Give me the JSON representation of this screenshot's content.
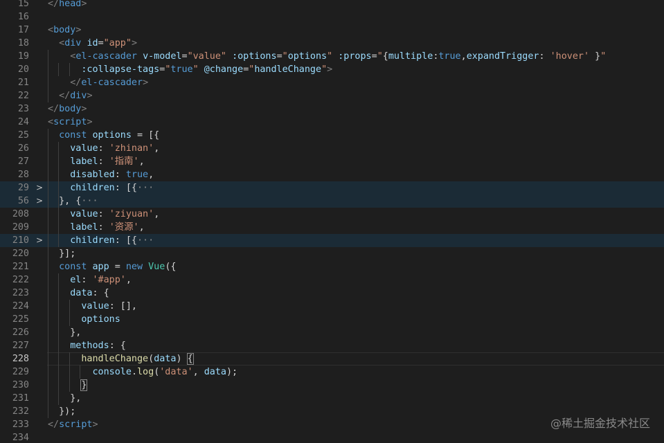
{
  "editor": {
    "lines": [
      {
        "num": "15",
        "segs": [
          [
            "t",
            "</"
          ],
          [
            "tn",
            "head"
          ],
          [
            "t",
            ">"
          ]
        ]
      },
      {
        "num": "16",
        "segs": []
      },
      {
        "num": "17",
        "segs": [
          [
            "t",
            "<"
          ],
          [
            "tn",
            "body"
          ],
          [
            "t",
            ">"
          ]
        ]
      },
      {
        "num": "18",
        "segs": [
          [
            "p",
            "  "
          ],
          [
            "t",
            "<"
          ],
          [
            "tn",
            "div"
          ],
          [
            "p",
            " "
          ],
          [
            "an",
            "id"
          ],
          [
            "p",
            "="
          ],
          [
            "s",
            "\"app\""
          ],
          [
            "t",
            ">"
          ]
        ]
      },
      {
        "num": "19",
        "segs": [
          [
            "p",
            "    "
          ],
          [
            "t",
            "<"
          ],
          [
            "tn",
            "el-cascader"
          ],
          [
            "p",
            " "
          ],
          [
            "an",
            "v-model"
          ],
          [
            "p",
            "="
          ],
          [
            "s",
            "\"value\""
          ],
          [
            "p",
            " "
          ],
          [
            "an",
            ":options"
          ],
          [
            "p",
            "="
          ],
          [
            "s",
            "\""
          ],
          [
            "v",
            "options"
          ],
          [
            "s",
            "\""
          ],
          [
            "p",
            " "
          ],
          [
            "an",
            ":props"
          ],
          [
            "p",
            "="
          ],
          [
            "s",
            "\""
          ],
          [
            "p",
            "{"
          ],
          [
            "v",
            "multiple"
          ],
          [
            "p",
            ":"
          ],
          [
            "k",
            "true"
          ],
          [
            "p",
            ","
          ],
          [
            "v",
            "expandTrigger"
          ],
          [
            "p",
            ": "
          ],
          [
            "s",
            "'hover'"
          ],
          [
            "p",
            " }"
          ],
          [
            "s",
            "\""
          ]
        ]
      },
      {
        "num": "20",
        "segs": [
          [
            "p",
            "      "
          ],
          [
            "an",
            ":collapse-tags"
          ],
          [
            "p",
            "="
          ],
          [
            "s",
            "\""
          ],
          [
            "k",
            "true"
          ],
          [
            "s",
            "\""
          ],
          [
            "p",
            " "
          ],
          [
            "an",
            "@change"
          ],
          [
            "p",
            "="
          ],
          [
            "s",
            "\""
          ],
          [
            "v",
            "handleChange"
          ],
          [
            "s",
            "\""
          ],
          [
            "t",
            ">"
          ]
        ]
      },
      {
        "num": "21",
        "segs": [
          [
            "p",
            "    "
          ],
          [
            "t",
            "</"
          ],
          [
            "tn",
            "el-cascader"
          ],
          [
            "t",
            ">"
          ]
        ]
      },
      {
        "num": "22",
        "segs": [
          [
            "p",
            "  "
          ],
          [
            "t",
            "</"
          ],
          [
            "tn",
            "div"
          ],
          [
            "t",
            ">"
          ]
        ]
      },
      {
        "num": "23",
        "segs": [
          [
            "t",
            "</"
          ],
          [
            "tn",
            "body"
          ],
          [
            "t",
            ">"
          ]
        ]
      },
      {
        "num": "24",
        "segs": [
          [
            "t",
            "<"
          ],
          [
            "tn",
            "script"
          ],
          [
            "t",
            ">"
          ]
        ]
      },
      {
        "num": "25",
        "segs": [
          [
            "p",
            "  "
          ],
          [
            "k",
            "const"
          ],
          [
            "p",
            " "
          ],
          [
            "v",
            "options"
          ],
          [
            "p",
            " = [{"
          ]
        ]
      },
      {
        "num": "26",
        "segs": [
          [
            "p",
            "    "
          ],
          [
            "v",
            "value"
          ],
          [
            "p",
            ": "
          ],
          [
            "s",
            "'zhinan'"
          ],
          [
            "p",
            ","
          ]
        ]
      },
      {
        "num": "27",
        "segs": [
          [
            "p",
            "    "
          ],
          [
            "v",
            "label"
          ],
          [
            "p",
            ": "
          ],
          [
            "s",
            "'指南'"
          ],
          [
            "p",
            ","
          ]
        ]
      },
      {
        "num": "28",
        "segs": [
          [
            "p",
            "    "
          ],
          [
            "v",
            "disabled"
          ],
          [
            "p",
            ": "
          ],
          [
            "k",
            "true"
          ],
          [
            "p",
            ","
          ]
        ]
      },
      {
        "num": "29",
        "segs": [
          [
            "p",
            "    "
          ],
          [
            "v",
            "children"
          ],
          [
            "p",
            ": [{"
          ],
          [
            "dots",
            "···"
          ]
        ],
        "fold": ">",
        "hl": true
      },
      {
        "num": "56",
        "segs": [
          [
            "p",
            "  }, {"
          ],
          [
            "dots",
            "···"
          ]
        ],
        "fold": ">",
        "hl": true
      },
      {
        "num": "208",
        "segs": [
          [
            "p",
            "    "
          ],
          [
            "v",
            "value"
          ],
          [
            "p",
            ": "
          ],
          [
            "s",
            "'ziyuan'"
          ],
          [
            "p",
            ","
          ]
        ]
      },
      {
        "num": "209",
        "segs": [
          [
            "p",
            "    "
          ],
          [
            "v",
            "label"
          ],
          [
            "p",
            ": "
          ],
          [
            "s",
            "'资源'"
          ],
          [
            "p",
            ","
          ]
        ]
      },
      {
        "num": "210",
        "segs": [
          [
            "p",
            "    "
          ],
          [
            "v",
            "children"
          ],
          [
            "p",
            ": [{"
          ],
          [
            "dots",
            "···"
          ]
        ],
        "fold": ">",
        "hl": true
      },
      {
        "num": "220",
        "segs": [
          [
            "p",
            "  }];"
          ]
        ]
      },
      {
        "num": "221",
        "segs": [
          [
            "p",
            "  "
          ],
          [
            "k",
            "const"
          ],
          [
            "p",
            " "
          ],
          [
            "v",
            "app"
          ],
          [
            "p",
            " = "
          ],
          [
            "k",
            "new"
          ],
          [
            "p",
            " "
          ],
          [
            "cls",
            "Vue"
          ],
          [
            "p",
            "({"
          ]
        ]
      },
      {
        "num": "222",
        "segs": [
          [
            "p",
            "    "
          ],
          [
            "v",
            "el"
          ],
          [
            "p",
            ": "
          ],
          [
            "s",
            "'#app'"
          ],
          [
            "p",
            ","
          ]
        ]
      },
      {
        "num": "223",
        "segs": [
          [
            "p",
            "    "
          ],
          [
            "v",
            "data"
          ],
          [
            "p",
            ": {"
          ]
        ]
      },
      {
        "num": "224",
        "segs": [
          [
            "p",
            "      "
          ],
          [
            "v",
            "value"
          ],
          [
            "p",
            ": [],"
          ]
        ]
      },
      {
        "num": "225",
        "segs": [
          [
            "p",
            "      "
          ],
          [
            "v",
            "options"
          ]
        ]
      },
      {
        "num": "226",
        "segs": [
          [
            "p",
            "    },"
          ]
        ]
      },
      {
        "num": "227",
        "segs": [
          [
            "p",
            "    "
          ],
          [
            "v",
            "methods"
          ],
          [
            "p",
            ": {"
          ]
        ]
      },
      {
        "num": "228",
        "segs": [
          [
            "p",
            "      "
          ],
          [
            "f",
            "handleChange"
          ],
          [
            "p",
            "("
          ],
          [
            "v",
            "data"
          ],
          [
            "p",
            ") "
          ],
          [
            "bm",
            "{"
          ]
        ],
        "cur": true
      },
      {
        "num": "229",
        "segs": [
          [
            "p",
            "        "
          ],
          [
            "v",
            "console"
          ],
          [
            "p",
            "."
          ],
          [
            "f",
            "log"
          ],
          [
            "p",
            "("
          ],
          [
            "s",
            "'data'"
          ],
          [
            "p",
            ", "
          ],
          [
            "v",
            "data"
          ],
          [
            "p",
            ");"
          ]
        ]
      },
      {
        "num": "230",
        "segs": [
          [
            "p",
            "      "
          ],
          [
            "bm",
            "}"
          ]
        ]
      },
      {
        "num": "231",
        "segs": [
          [
            "p",
            "    },"
          ]
        ]
      },
      {
        "num": "232",
        "segs": [
          [
            "p",
            "  });"
          ]
        ]
      },
      {
        "num": "233",
        "segs": [
          [
            "t",
            "</"
          ],
          [
            "tn",
            "script"
          ],
          [
            "t",
            ">"
          ]
        ]
      },
      {
        "num": "234",
        "segs": []
      }
    ]
  },
  "watermark": "@稀土掘金技术社区",
  "colors": {
    "background": "#1e1e1e",
    "line_highlight": "#1b2b36",
    "tag": "#569cd6",
    "attribute": "#9cdcfe",
    "string": "#ce9178",
    "function": "#dcdcaa",
    "class": "#4ec9b0"
  },
  "icons": {
    "fold": "chevron-right-icon"
  }
}
